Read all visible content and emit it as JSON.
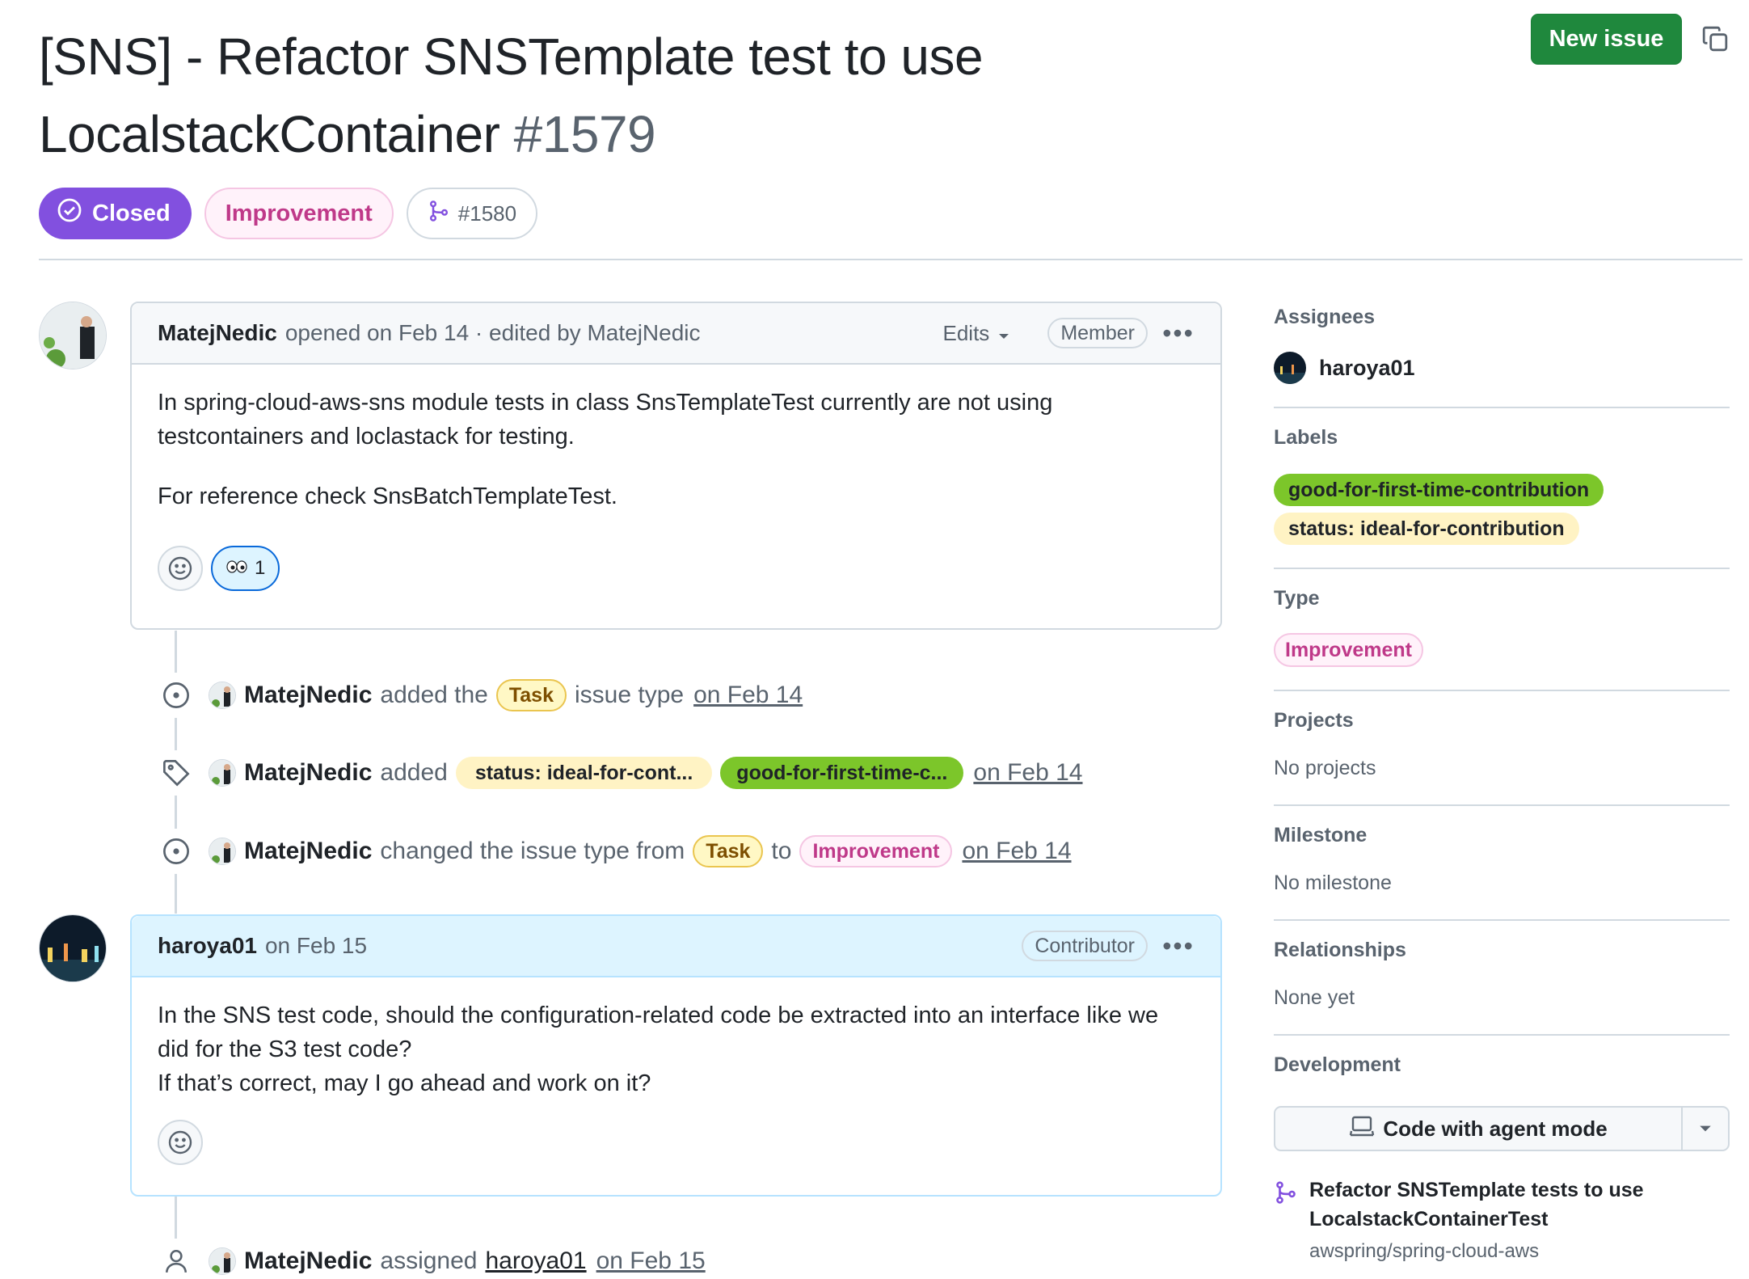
{
  "issue": {
    "title": "[SNS] - Refactor SNSTemplate test to use LocalstackContainer",
    "number": "#1579",
    "state": "Closed",
    "type": "Improvement",
    "linked_pr": "#1580",
    "new_issue_label": "New issue"
  },
  "first_comment": {
    "author": "MatejNedic",
    "meta": "opened on Feb 14 · edited by MatejNedic",
    "edits_label": "Edits",
    "role": "Member",
    "body_1": "In spring-cloud-aws-sns module tests in class SnsTemplateTest currently are not using testcontainers and loclastack for testing.",
    "body_2": "For reference check SnsBatchTemplateTest.",
    "reaction_count": "1"
  },
  "events": [
    {
      "author": "MatejNedic",
      "text_1": "added the",
      "chip": "Task",
      "text_2": "issue type",
      "date": "on Feb 14"
    },
    {
      "author": "MatejNedic",
      "text_1": "added",
      "chip_a": "status: ideal-for-cont...",
      "chip_b": "good-for-first-time-c...",
      "date": "on Feb 14"
    },
    {
      "author": "MatejNedic",
      "text_1": "changed the issue type from",
      "chip_a": "Task",
      "text_2": "to",
      "chip_b": "Improvement",
      "date": "on Feb 14"
    },
    {
      "author": "MatejNedic",
      "text_1": "assigned",
      "user": "haroya01",
      "date": "on Feb 15"
    }
  ],
  "second_comment": {
    "author": "haroya01",
    "meta": "on Feb 15",
    "role": "Contributor",
    "body_1": "In the SNS test code, should the configuration-related code be extracted into an interface like we did for the S3 test code?",
    "body_2": "If that’s correct, may I go ahead and work on it?"
  },
  "sidebar": {
    "assignees_heading": "Assignees",
    "assignee": "haroya01",
    "labels_heading": "Labels",
    "labels": [
      "good-for-first-time-contribution",
      "status: ideal-for-contribution"
    ],
    "type_heading": "Type",
    "type_value": "Improvement",
    "projects_heading": "Projects",
    "projects_value": "No projects",
    "milestone_heading": "Milestone",
    "milestone_value": "No milestone",
    "relationships_heading": "Relationships",
    "relationships_value": "None yet",
    "development_heading": "Development",
    "agent_button": "Code with agent mode",
    "dev_title": "Refactor SNSTemplate tests to use LocalstackContainerTest",
    "dev_repo": "awspring/spring-cloud-aws"
  },
  "colors": {
    "closed": "#8250df",
    "primary_button": "#1f883d",
    "good_label": "#7cc62a",
    "status_label": "#fff3c4",
    "improvement": "#bf3989"
  }
}
